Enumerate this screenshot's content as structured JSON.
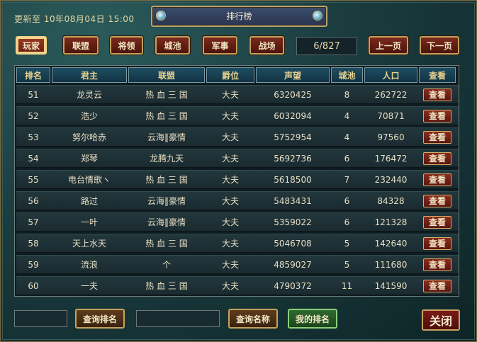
{
  "window": {
    "title": "排行榜",
    "update_text": "更新至 10年08月04日 15:00"
  },
  "tabs": [
    {
      "label": "玩家"
    },
    {
      "label": "联盟"
    },
    {
      "label": "将领"
    },
    {
      "label": "城池"
    },
    {
      "label": "军事"
    },
    {
      "label": "战场"
    }
  ],
  "pagination": {
    "page_text": "6/827",
    "prev_label": "上一页",
    "next_label": "下一页"
  },
  "table": {
    "headers": [
      "排名",
      "君主",
      "联盟",
      "爵位",
      "声望",
      "城池",
      "人口",
      "查看"
    ],
    "rows": [
      {
        "rank": "51",
        "lord": "龙灵云",
        "alliance": "热 血 三 国",
        "title": "大夫",
        "prestige": "6320425",
        "cities": "8",
        "population": "262722",
        "view": "查看"
      },
      {
        "rank": "52",
        "lord": "浩少",
        "alliance": "热 血 三 国",
        "title": "大夫",
        "prestige": "6032094",
        "cities": "4",
        "population": "70871",
        "view": "查看"
      },
      {
        "rank": "53",
        "lord": "努尔哈赤",
        "alliance": "云海‖豪情",
        "title": "大夫",
        "prestige": "5752954",
        "cities": "4",
        "population": "97560",
        "view": "查看"
      },
      {
        "rank": "54",
        "lord": "郑琴",
        "alliance": "龙腾九天",
        "title": "大夫",
        "prestige": "5692736",
        "cities": "6",
        "population": "176472",
        "view": "查看"
      },
      {
        "rank": "55",
        "lord": "电台情歌ヽ",
        "alliance": "热 血 三 国",
        "title": "大夫",
        "prestige": "5618500",
        "cities": "7",
        "population": "232440",
        "view": "查看"
      },
      {
        "rank": "56",
        "lord": "路过",
        "alliance": "云海‖豪情",
        "title": "大夫",
        "prestige": "5483431",
        "cities": "6",
        "population": "84328",
        "view": "查看"
      },
      {
        "rank": "57",
        "lord": "一叶",
        "alliance": "云海‖豪情",
        "title": "大夫",
        "prestige": "5359022",
        "cities": "6",
        "population": "121328",
        "view": "查看"
      },
      {
        "rank": "58",
        "lord": "天上水天",
        "alliance": "热 血 三 国",
        "title": "大夫",
        "prestige": "5046708",
        "cities": "5",
        "population": "142640",
        "view": "查看"
      },
      {
        "rank": "59",
        "lord": "流浪",
        "alliance": "个",
        "title": "大夫",
        "prestige": "4859027",
        "cities": "5",
        "population": "111680",
        "view": "查看"
      },
      {
        "rank": "60",
        "lord": "一夫",
        "alliance": "热 血 三 国",
        "title": "大夫",
        "prestige": "4790372",
        "cities": "11",
        "population": "141590",
        "view": "查看"
      }
    ]
  },
  "bottom": {
    "rank_input_value": "",
    "query_rank_label": "查询排名",
    "name_input_value": "",
    "query_name_label": "查询名称",
    "my_rank_label": "我的排名",
    "close_label": "关闭"
  },
  "colors": {
    "accent_gold": "#c5a25d",
    "button_red": "#7a2a1c",
    "header_blue": "#1e4d62"
  }
}
